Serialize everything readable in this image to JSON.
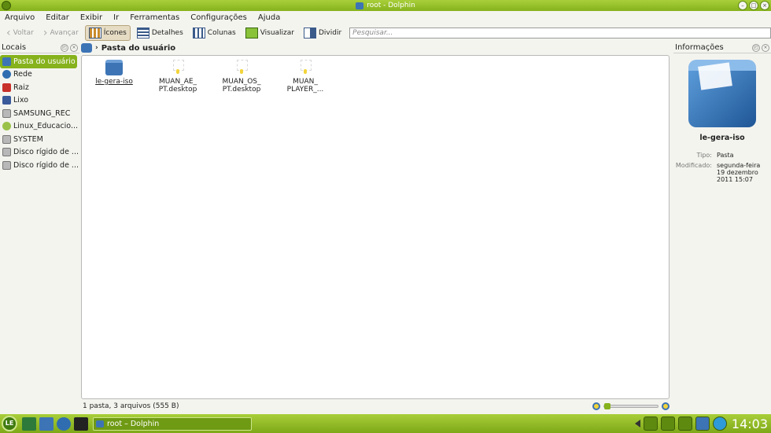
{
  "window": {
    "title": "root - Dolphin"
  },
  "menu": [
    "Arquivo",
    "Editar",
    "Exibir",
    "Ir",
    "Ferramentas",
    "Configurações",
    "Ajuda"
  ],
  "toolbar": {
    "back": "Voltar",
    "forward": "Avançar",
    "icons": "Ícones",
    "details": "Detalhes",
    "columns": "Colunas",
    "preview": "Visualizar",
    "split": "Dividir",
    "search_placeholder": "Pesquisar..."
  },
  "places": {
    "title": "Locais",
    "items": [
      {
        "label": "Pasta do usuário",
        "icon": "home-folder-icon",
        "selected": true
      },
      {
        "label": "Rede",
        "icon": "network-icon"
      },
      {
        "label": "Raiz",
        "icon": "root-folder-icon"
      },
      {
        "label": "Lixo",
        "icon": "trash-icon"
      },
      {
        "label": "SAMSUNG_REC",
        "icon": "hard-disk-icon"
      },
      {
        "label": "Linux_Educacio...",
        "icon": "usb-drive-icon"
      },
      {
        "label": "SYSTEM",
        "icon": "hard-disk-icon"
      },
      {
        "label": "Disco rígido de ...",
        "icon": "hard-disk-icon"
      },
      {
        "label": "Disco rígido de ...",
        "icon": "hard-disk-icon"
      }
    ]
  },
  "breadcrumb": {
    "location": "Pasta do usuário"
  },
  "files": [
    {
      "name": "le-gera-iso",
      "type": "folder"
    },
    {
      "name": "MUAN_AE_\nPT.desktop",
      "type": "desktop"
    },
    {
      "name": "MUAN_OS_\nPT.desktop",
      "type": "desktop"
    },
    {
      "name": "MUAN_\nPLAYER_...",
      "type": "desktop"
    }
  ],
  "status": {
    "text": "1 pasta, 3 arquivos (555 B)"
  },
  "info": {
    "title": "Informações",
    "name": "le-gera-iso",
    "type_label": "Tipo:",
    "type_value": "Pasta",
    "modified_label": "Modificado:",
    "modified_value": "segunda-feira\n19 dezembro\n2011 15:07"
  },
  "taskbar": {
    "start_label": "LE",
    "task_title": "root – Dolphin",
    "clock": "14:03"
  }
}
